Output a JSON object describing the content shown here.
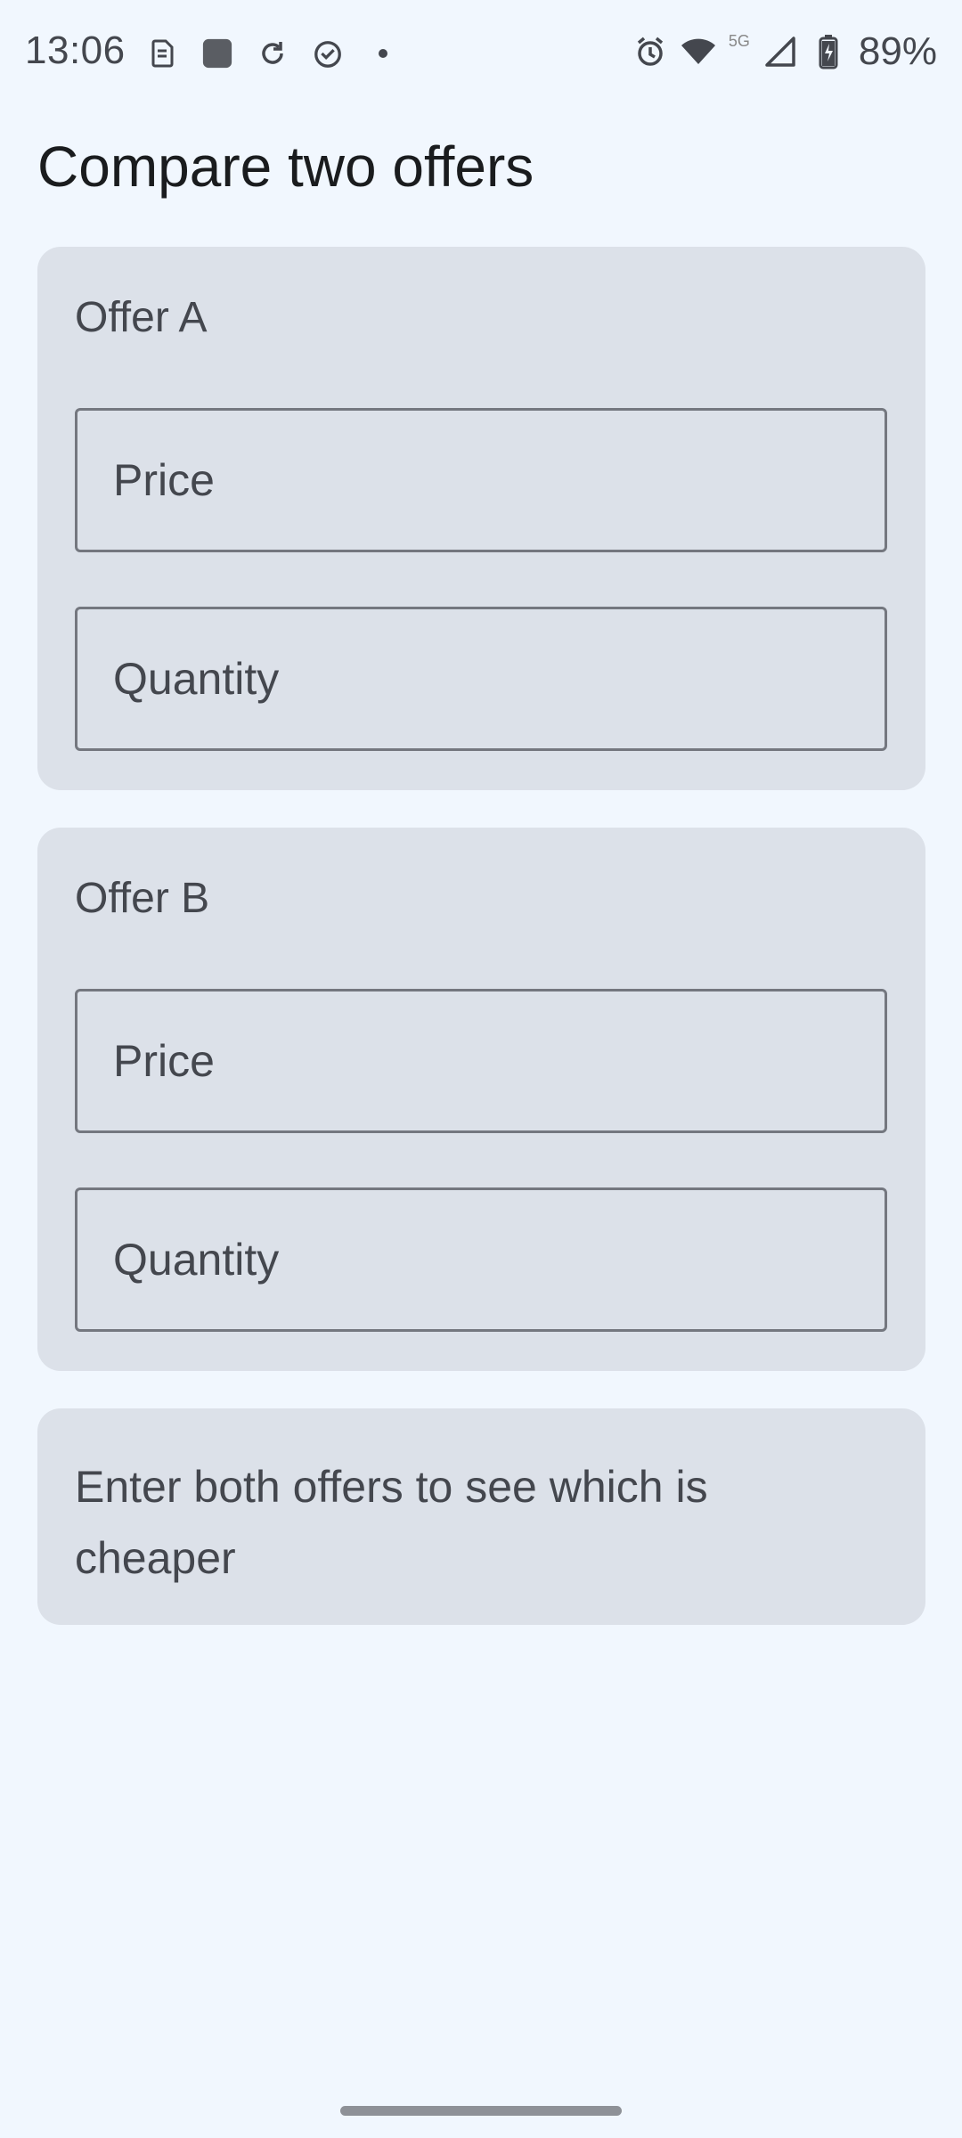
{
  "status_bar": {
    "time": "13:06",
    "battery": "89%",
    "network": "5G",
    "left_icons": [
      "sim-icon",
      "app-square-icon",
      "sync-icon",
      "clock-check-icon",
      "dot-icon"
    ],
    "right_icons": [
      "alarm-icon",
      "wifi-icon",
      "signal-icon",
      "battery-charging-icon"
    ]
  },
  "page": {
    "title": "Compare two offers"
  },
  "offers": [
    {
      "title": "Offer A",
      "price_placeholder": "Price",
      "quantity_placeholder": "Quantity"
    },
    {
      "title": "Offer B",
      "price_placeholder": "Price",
      "quantity_placeholder": "Quantity"
    }
  ],
  "result": {
    "message": "Enter both offers to see which is cheaper"
  },
  "colors": {
    "background": "#F1F7FE",
    "card": "#DCE1E9",
    "text": "#44474E",
    "title": "#1A1C1E",
    "outline": "#74777F"
  }
}
